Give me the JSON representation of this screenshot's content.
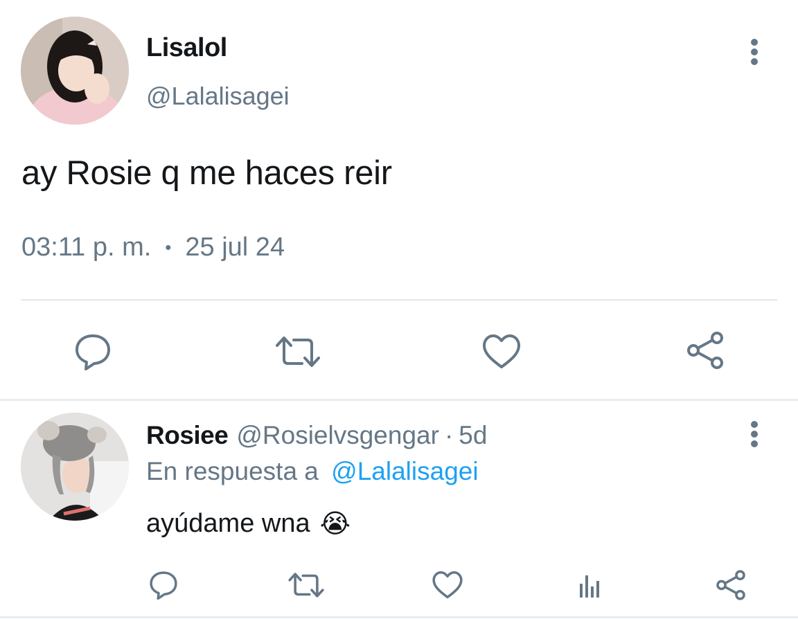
{
  "main_tweet": {
    "display_name": "Lisalol",
    "handle": "@Lalalisagei",
    "text": "ay Rosie q me haces reir",
    "time": "03:11 p. m.",
    "separator": "•",
    "date": "25 jul 24",
    "avatar_icon": "profile-photo-icon"
  },
  "reply": {
    "display_name": "Rosiee",
    "handle": "@Rosielvsgengar",
    "meta_sep": "·",
    "age": "5d",
    "reply_prefix": "En respuesta a",
    "reply_to": "@Lalalisagei",
    "text": "ayúdame wna",
    "emoji": "😭",
    "avatar_icon": "profile-photo-icon"
  },
  "colors": {
    "text": "#14171a",
    "muted": "#657786",
    "link": "#1da1f2",
    "divider": "#e1e8ed"
  }
}
